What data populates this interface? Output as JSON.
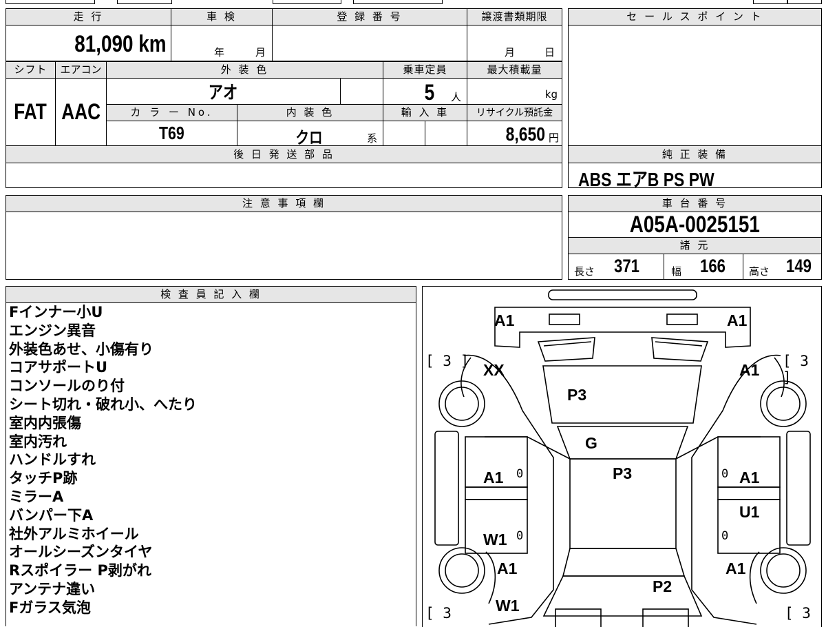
{
  "top": {
    "mileage_label": "走 行",
    "mileage_value": "81,090 km",
    "shaken_label": "車 検",
    "shaken_year": "年",
    "shaken_month": "月",
    "reg_label": "登 録 番 号",
    "transfer_label": "譲渡書類期限",
    "transfer_month": "月",
    "transfer_day": "日",
    "shift_label": "シフト",
    "shift_value": "FAT",
    "ac_label": "エアコン",
    "ac_value": "AAC",
    "exterior_label": "外 装 色",
    "exterior_value": "アオ",
    "capacity_label": "乗車定員",
    "capacity_value": "5",
    "capacity_unit": "人",
    "maxload_label": "最大積載量",
    "maxload_unit": "kg",
    "color_no_label": "カ ラ ー No.",
    "color_no_value": "T69",
    "interior_label": "内 装 色",
    "interior_value": "クロ",
    "interior_unit": "系",
    "import_label": "輸 入 車",
    "recycle_label": "リサイクル預託金",
    "recycle_value": "8,650",
    "recycle_unit": "円",
    "later_parts_label": "後 日 発 送 部 品"
  },
  "right": {
    "sales_point_label": "セ ー ル ス ポ イ ン ト",
    "equipment_label": "純 正 装 備",
    "equipment_value": "ABS エアB PS PW",
    "chassis_label": "車 台 番 号",
    "chassis_value": "A05A-0025151",
    "specs_label": "諸 元",
    "length_label": "長さ",
    "length_value": "371",
    "width_label": "幅",
    "width_value": "166",
    "height_label": "高さ",
    "height_value": "149"
  },
  "notes_label": "注 意 事 項 欄",
  "inspector": {
    "label": "検 査 員 記 入 欄",
    "lines": [
      "Fインナー小U",
      "エンジン異音",
      "外装色あせ、小傷有り",
      "コアサポートU",
      "コンソールのり付",
      "シート切れ・破れ小、へたり",
      "室内内張傷",
      "室内汚れ",
      "ハンドルすれ",
      "タッチP跡",
      "ミラーA",
      "バンパー下A",
      "社外アルミホイール",
      "オールシーズンタイヤ",
      "Rスポイラー P剥がれ",
      "アンテナ違い",
      "Fガラス気泡"
    ]
  },
  "diagram": {
    "front_left": "A1",
    "front_right": "A1",
    "bracket_tl": "[ 3 ]",
    "bracket_tr": "[ 3 ]",
    "bracket_bl": "[ 3",
    "bracket_br": "[ 3",
    "fender_left": "XX",
    "fender_right": "A1",
    "hood": "P3",
    "windshield": "G",
    "roof": "P3",
    "front_door_left": "A1",
    "front_door_right": "A1",
    "rear_door_right": "U1",
    "rear_door_left": "W1",
    "rear_fender_left": "A1",
    "rear_fender_right": "A1",
    "rear_panel": "P2",
    "rear_left_low": "W1",
    "zero": "0"
  }
}
